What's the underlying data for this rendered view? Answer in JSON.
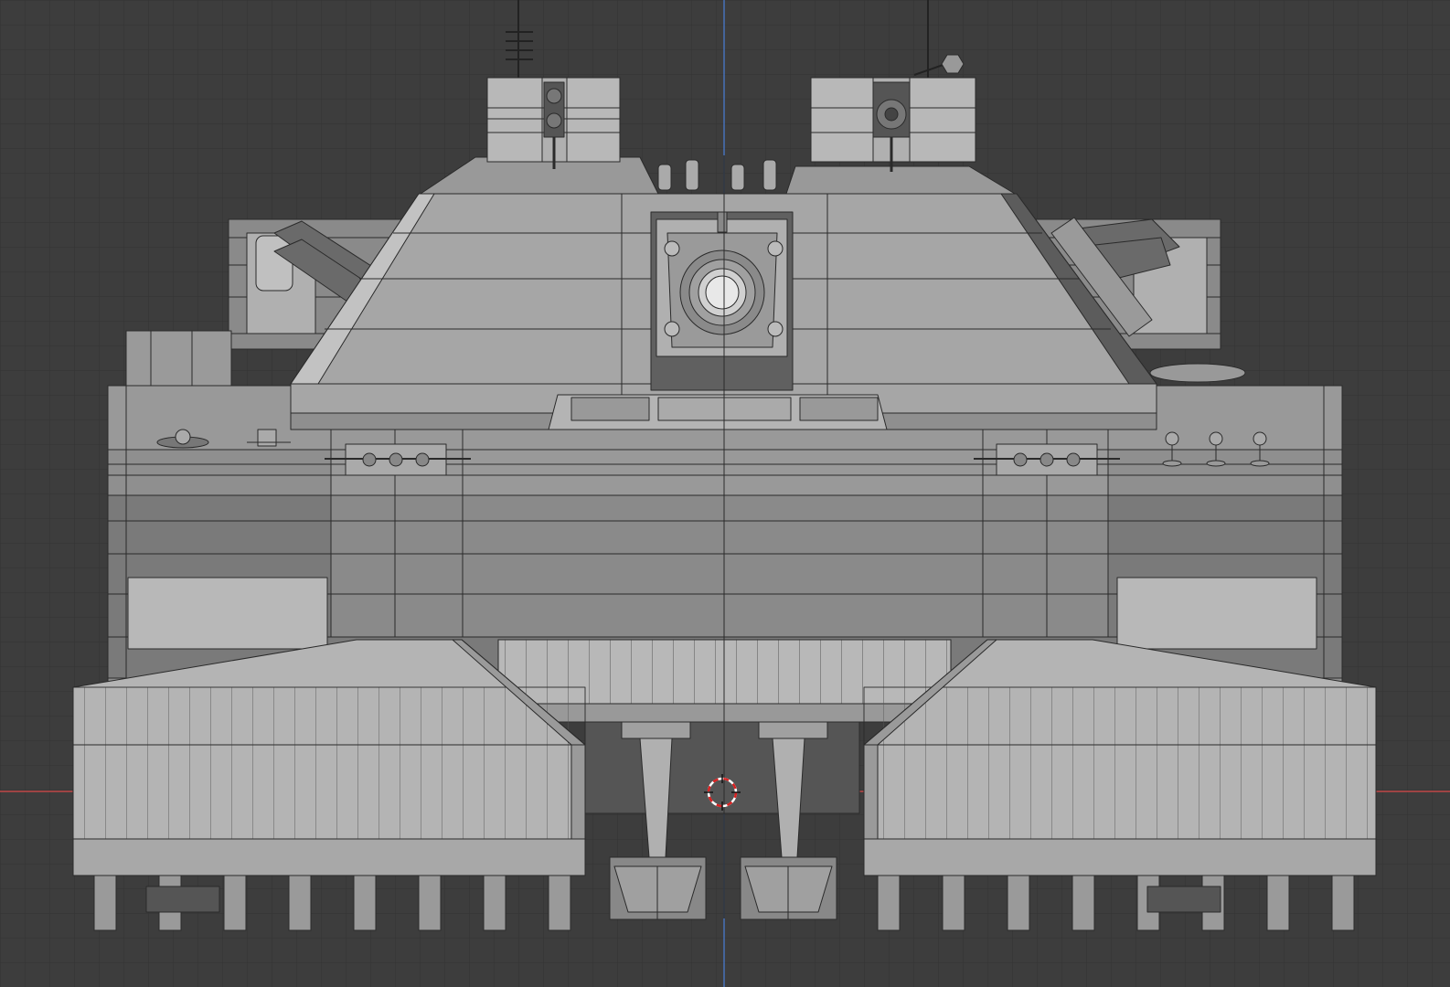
{
  "viewport": {
    "view": "front-orthographic",
    "shading": "solid",
    "overlay": "wireframe",
    "subject": "tank-model",
    "colors": {
      "background": "#3d3d3d",
      "grid": "#333333",
      "x_axis": "#d94a4a",
      "z_axis": "#4a7fd9",
      "mesh_light": "#a8a8a8",
      "mesh_mid": "#8f8f8f",
      "mesh_dark": "#6e6e6e",
      "wire": "#2a2a2a",
      "cursor_red": "#d92020",
      "cursor_white": "#ffffff"
    }
  }
}
